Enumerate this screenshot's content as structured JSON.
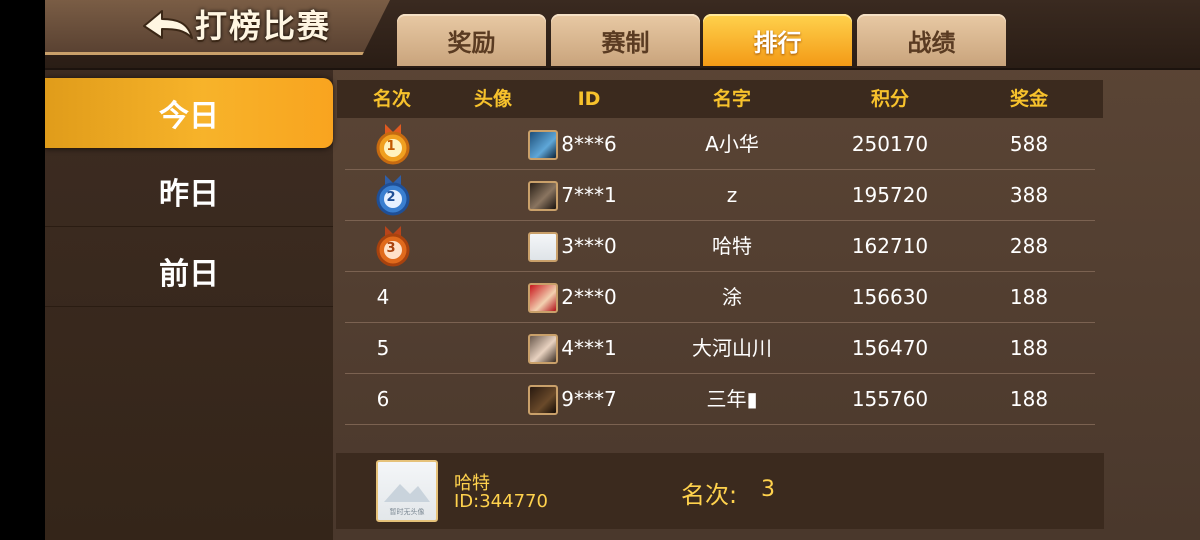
{
  "header": {
    "title": "打榜比赛",
    "tabs": [
      {
        "label": "奖励"
      },
      {
        "label": "赛制"
      },
      {
        "label": "排行"
      },
      {
        "label": "战绩"
      }
    ]
  },
  "sidebar": {
    "items": [
      {
        "label": "今日"
      },
      {
        "label": "昨日"
      },
      {
        "label": "前日"
      }
    ]
  },
  "table": {
    "headers": {
      "rank": "名次",
      "avatar": "头像",
      "id": "ID",
      "name": "名字",
      "score": "积分",
      "prize": "奖金"
    },
    "rows": [
      {
        "rank": "1",
        "id": "8***6",
        "name": "A小华",
        "score": "250170",
        "prize": "588"
      },
      {
        "rank": "2",
        "id": "7***1",
        "name": "z",
        "score": "195720",
        "prize": "388"
      },
      {
        "rank": "3",
        "id": "3***0",
        "name": "哈特",
        "score": "162710",
        "prize": "288"
      },
      {
        "rank": "4",
        "id": "2***0",
        "name": "涂",
        "score": "156630",
        "prize": "188"
      },
      {
        "rank": "5",
        "id": "4***1",
        "name": "大河山川",
        "score": "156470",
        "prize": "188"
      },
      {
        "rank": "6",
        "id": "9***7",
        "name": "三年▮",
        "score": "155760",
        "prize": "188"
      }
    ]
  },
  "self": {
    "name": "哈特",
    "id": "ID:344770",
    "rank_label": "名次:",
    "rank_value": "3",
    "avatar_caption": "暂时无头像"
  },
  "colors": {
    "accent": "#f7c22c",
    "tab_active": "#f39a16",
    "gold_medal": "#f0a020",
    "silver_medal": "#3a7fd0",
    "bronze_medal": "#e06a1c"
  }
}
